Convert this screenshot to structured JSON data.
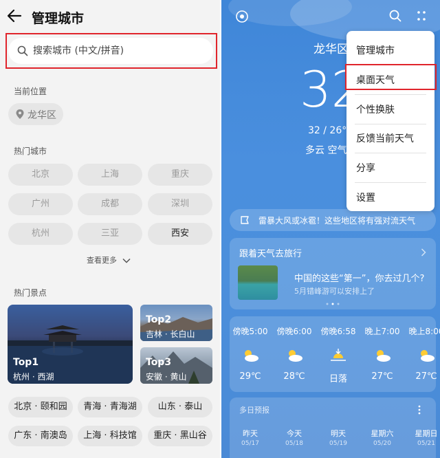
{
  "left": {
    "title": "管理城市",
    "search": {
      "placeholder": "搜索城市 (中文/拼音)"
    },
    "current_location": {
      "label": "当前位置",
      "value": "龙华区"
    },
    "hot_cities": {
      "label": "热门城市",
      "items": [
        "北京",
        "上海",
        "重庆",
        "广州",
        "成都",
        "深圳",
        "杭州",
        "三亚",
        "西安"
      ]
    },
    "see_more": "查看更多",
    "hot_spots": {
      "label": "热门景点",
      "cards": [
        {
          "rank": "Top1",
          "name": "杭州 · 西湖"
        },
        {
          "rank": "Top2",
          "name": "吉林 · 长白山"
        },
        {
          "rank": "Top3",
          "name": "安徽 · 黄山"
        }
      ],
      "tags": [
        "北京 · 颐和园",
        "青海 · 青海湖",
        "山东 · 泰山",
        "广东 · 南澳岛",
        "上海 · 科技馆",
        "重庆 · 黑山谷"
      ]
    }
  },
  "right": {
    "city": "龙华区",
    "temp": "32",
    "range": "32 / 26°",
    "condition": "多云 空气",
    "menu": [
      "管理城市",
      "桌面天气",
      "个性换肤",
      "反馈当前天气",
      "分享",
      "设置"
    ],
    "alert": "雷暴大风或冰雹！这些地区将有强对流天气",
    "travel": {
      "title": "跟着天气去旅行",
      "question": "中国的这些“第一”，你去过几个?",
      "sub": "5月错峰游可以安排上了"
    },
    "hourly": [
      {
        "time": "傍晚5:00",
        "temp": "29℃"
      },
      {
        "time": "傍晚6:00",
        "temp": "28℃"
      },
      {
        "time": "傍晚6:58",
        "temp": "日落"
      },
      {
        "time": "晚上7:00",
        "temp": "27℃"
      },
      {
        "time": "晚上8:00",
        "temp": "27℃"
      }
    ],
    "forecast": {
      "title": "多日预报",
      "days": [
        {
          "day": "昨天",
          "date": "05/17"
        },
        {
          "day": "今天",
          "date": "05/18"
        },
        {
          "day": "明天",
          "date": "05/19"
        },
        {
          "day": "星期六",
          "date": "05/20"
        },
        {
          "day": "星期日",
          "date": "05/21"
        }
      ]
    }
  }
}
